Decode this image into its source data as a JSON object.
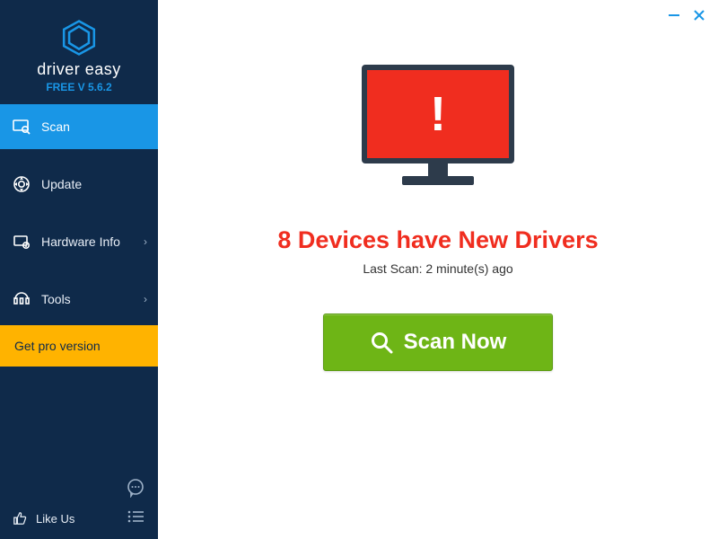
{
  "app": {
    "name": "driver easy",
    "version": "FREE V 5.6.2"
  },
  "sidebar": {
    "items": [
      {
        "label": "Scan",
        "has_chevron": false,
        "active": true
      },
      {
        "label": "Update",
        "has_chevron": false,
        "active": false
      },
      {
        "label": "Hardware Info",
        "has_chevron": true,
        "active": false
      },
      {
        "label": "Tools",
        "has_chevron": true,
        "active": false
      }
    ],
    "pro_label": "Get pro version",
    "like_us_label": "Like Us"
  },
  "main": {
    "headline": "8 Devices have New Drivers",
    "subline": "Last Scan: 2 minute(s) ago",
    "scan_button": "Scan Now",
    "alert_glyph": "!"
  },
  "colors": {
    "sidebar_bg": "#0f2a4a",
    "accent": "#1996e6",
    "pro": "#ffb300",
    "alert": "#f02d1f",
    "scan_btn": "#6eb516"
  }
}
